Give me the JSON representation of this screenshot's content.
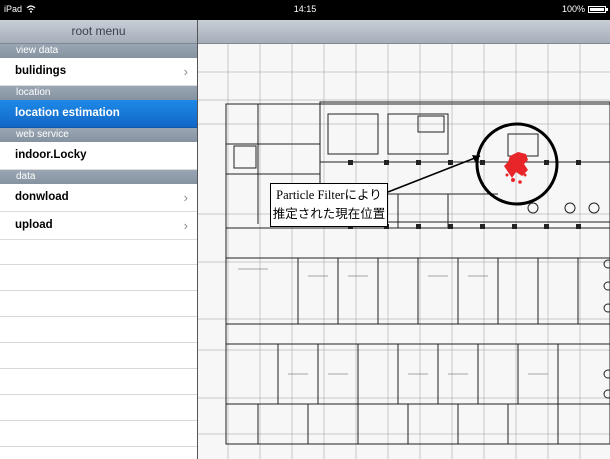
{
  "status_bar": {
    "device": "iPad",
    "time": "14:15",
    "battery": "100%",
    "battery_level": 1.0
  },
  "sidebar": {
    "title": "root menu",
    "sections": [
      {
        "header": "view data",
        "items": [
          {
            "label": "bulidings",
            "chevron": true,
            "selected": false
          }
        ]
      },
      {
        "header": "location",
        "items": [
          {
            "label": "location estimation",
            "chevron": false,
            "selected": true
          }
        ]
      },
      {
        "header": "web service",
        "items": [
          {
            "label": "indoor.Locky",
            "chevron": false,
            "selected": false
          }
        ]
      },
      {
        "header": "data",
        "items": [
          {
            "label": "donwload",
            "chevron": true,
            "selected": false
          },
          {
            "label": "upload",
            "chevron": true,
            "selected": false
          }
        ]
      }
    ]
  },
  "map": {
    "callout_line1": "Particle Filterにより",
    "callout_line2": "推定された現在位置",
    "particle_color": "#e8262a"
  },
  "colors": {
    "accent": "#1a7de0",
    "nav_bar": "#b4bcc6",
    "section_header": "#8e9aa8"
  }
}
